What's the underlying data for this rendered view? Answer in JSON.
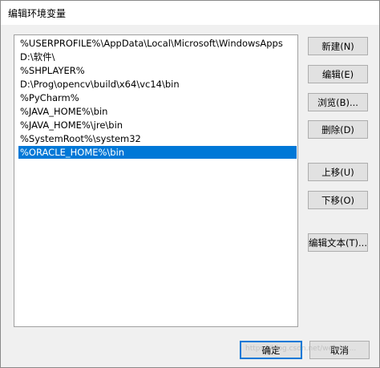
{
  "window": {
    "title": "编辑环境变量"
  },
  "list": {
    "items": [
      {
        "text": "%USERPROFILE%\\AppData\\Local\\Microsoft\\WindowsApps",
        "selected": false
      },
      {
        "text": "D:\\软件\\",
        "selected": false
      },
      {
        "text": "%SHPLAYER%",
        "selected": false
      },
      {
        "text": "D:\\Prog\\opencv\\build\\x64\\vc14\\bin",
        "selected": false
      },
      {
        "text": "%PyCharm%",
        "selected": false
      },
      {
        "text": "%JAVA_HOME%\\bin",
        "selected": false
      },
      {
        "text": "%JAVA_HOME%\\jre\\bin",
        "selected": false
      },
      {
        "text": "%SystemRoot%\\system32",
        "selected": false
      },
      {
        "text": "%ORACLE_HOME%\\bin",
        "selected": true
      }
    ]
  },
  "buttons": {
    "new": "新建(N)",
    "edit": "编辑(E)",
    "browse": "浏览(B)...",
    "delete": "删除(D)",
    "move_up": "上移(U)",
    "move_down": "下移(O)",
    "edit_text": "编辑文本(T)...",
    "ok": "确定",
    "cancel": "取消"
  },
  "watermark": "https://blog.csdn.net/weixin_..."
}
